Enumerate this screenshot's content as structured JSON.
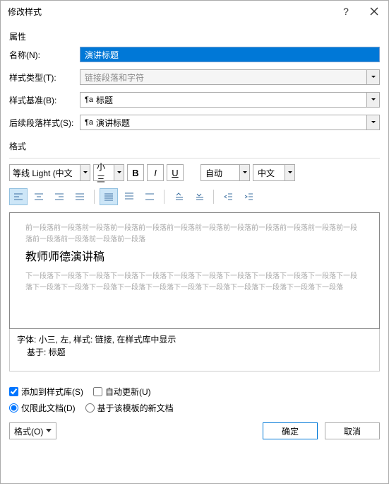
{
  "title": "修改样式",
  "section1": "属性",
  "labels": {
    "name": "名称(N):",
    "styleType": "样式类型(T):",
    "basedOn": "样式基准(B):",
    "nextStyle": "后续段落样式(S):"
  },
  "values": {
    "name": "演讲标题",
    "styleType": "链接段落和字符",
    "basedOn": "标题",
    "nextStyle": "演讲标题"
  },
  "section2": "格式",
  "format": {
    "font": "等线 Light (中文",
    "size": "小三",
    "bold": "B",
    "italic": "I",
    "underline": "U",
    "color": "自动",
    "lang": "中文"
  },
  "preview": {
    "before": "前一段落前一段落前一段落前一段落前一段落前一段落前一段落前一段落前一段落前一段落前一段落前一段落前一段落前一段落前一段落前一段落",
    "sample": "教师师德演讲稿",
    "after": "下一段落下一段落下一段落下一段落下一段落下一段落下一段落下一段落下一段落下一段落下一段落下一段落下一段落下一段落下一段落下一段落下一段落下一段落下一段落下一段落下一段落下一段落下一段落"
  },
  "desc": {
    "l1": "字体: 小三, 左, 样式: 链接, 在样式库中显示",
    "l2": "基于: 标题"
  },
  "chk": {
    "addToGallery": "添加到样式库(S)",
    "autoUpdate": "自动更新(U)"
  },
  "radio": {
    "thisDoc": "仅限此文档(D)",
    "template": "基于该模板的新文档"
  },
  "footer": {
    "formatBtn": "格式(O)",
    "ok": "确定",
    "cancel": "取消"
  }
}
